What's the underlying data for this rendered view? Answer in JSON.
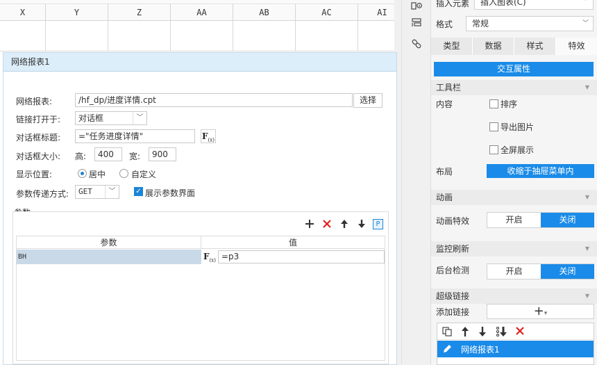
{
  "sheet": {
    "columns": [
      "X",
      "Y",
      "Z",
      "AA",
      "AB",
      "AC",
      "AI"
    ]
  },
  "dialog": {
    "title": "网络报表1",
    "report_label": "网络报表:",
    "report_path": "/hf_dp/进度详情.cpt",
    "choose_button": "选择",
    "open_in_label": "链接打开于:",
    "open_in_value": "对话框",
    "dialog_title_label": "对话框标题:",
    "dialog_title_value": "=\"任务进度详情\"",
    "fx_label": "F",
    "fx_sub": "(x)",
    "dialog_size_label": "对话框大小:",
    "height_label": "高:",
    "height_value": "400",
    "width_label": "宽:",
    "width_value": "900",
    "position_label": "显示位置:",
    "position_center": "居中",
    "position_custom": "自定义",
    "param_method_label": "参数传递方式:",
    "param_method_value": "GET",
    "show_param_ui_label": "展示参数界面",
    "params_section_label": "参数",
    "params_table": {
      "headers": [
        "参数",
        "值"
      ],
      "rows": [
        {
          "param": "BH",
          "value": "=p3"
        }
      ]
    },
    "param_p_badge": "P"
  },
  "panel": {
    "insert_element": "插入元素",
    "insert_chart": "插入图表(C)",
    "format_label": "格式",
    "format_value": "常规",
    "tabs": [
      "类型",
      "数据",
      "样式",
      "特效"
    ],
    "interact_header": "交互属性",
    "toolbar_section": "工具栏",
    "content_label": "内容",
    "opt_sort": "排序",
    "opt_export_image": "导出图片",
    "opt_fullscreen": "全屏展示",
    "layout_label": "布局",
    "layout_value": "收缩于抽屉菜单内",
    "animation_section": "动画",
    "animation_effect_label": "动画特效",
    "on": "开启",
    "off": "关闭",
    "monitor_section": "监控刷新",
    "backend_check_label": "后台检测",
    "hyperlink_section": "超级链接",
    "add_link_label": "添加链接",
    "add_link_plus": "+",
    "link_item": "网络报表1"
  },
  "colors": {
    "accent": "#1a8be8",
    "dialog_title_bg": "#dceefa",
    "selected_row": "#c9d9e8"
  }
}
